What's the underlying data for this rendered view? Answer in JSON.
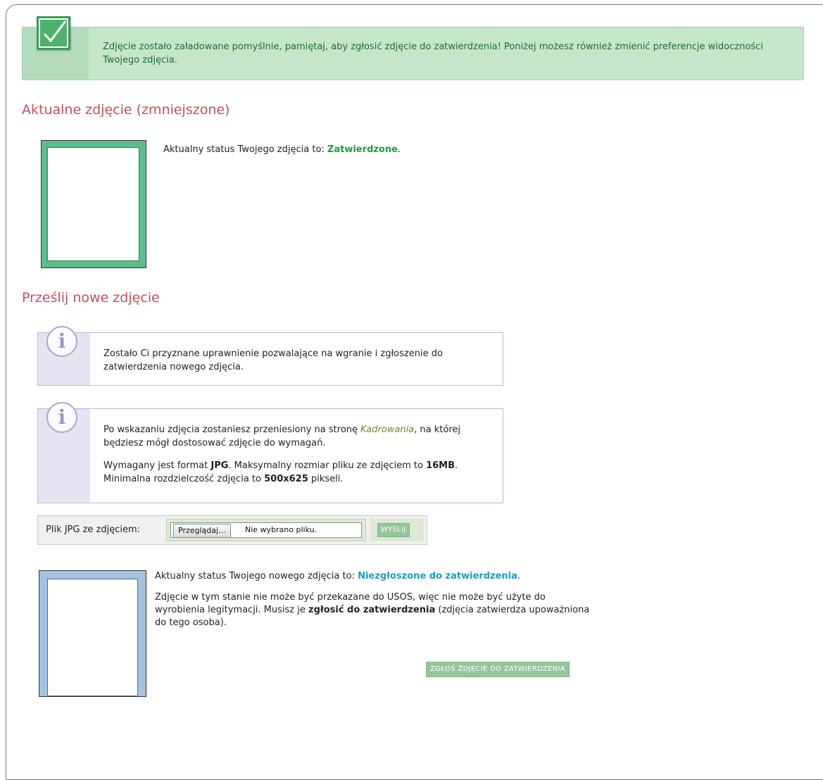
{
  "success_banner": {
    "message": "Zdjęcie zostało załadowane pomyślnie, pamiętaj, aby zgłosić zdjęcie do zatwierdzenia! Poniżej możesz również zmienić preferencje widoczności Twojego zdjęcia.",
    "icon": "checkmark-icon"
  },
  "current_photo": {
    "heading": "Aktualne zdjęcie (zmniejszone)",
    "status_prefix": "Aktualny status Twojego zdjęcia to: ",
    "status_value": "Zatwierdzone",
    "status_suffix": ".",
    "status_color": "#1e9e3c"
  },
  "new_photo": {
    "heading": "Prześlij nowe zdjęcie",
    "info1": {
      "icon": "info-icon",
      "text": "Zostało Ci przyznane uprawnienie pozwalające na wgranie i zgłoszenie do zatwierdzenia nowego zdjęcia."
    },
    "info2": {
      "icon": "info-icon",
      "p1_before": "Po wskazaniu zdjęcia zostaniesz przeniesiony na stronę ",
      "p1_link": "Kadrowania",
      "p1_after": ", na której będziesz mógł dostosować zdjęcie do wymagań.",
      "p2_a": "Wymagany jest format ",
      "p2_format": "JPG",
      "p2_b": ". Maksymalny rozmiar pliku ze zdjęciem to ",
      "p2_size": "16MB",
      "p2_c": ". Minimalna rozdzielczość zdjęcia to ",
      "p2_res": "500x625",
      "p2_d": " pikseli."
    },
    "upload": {
      "label": "Plik JPG ze zdjęciem:",
      "browse_label": "Przeglądaj...",
      "no_file_text": "Nie wybrano pliku.",
      "send_label": "WYŚLIJ"
    },
    "status_prefix": "Aktualny status Twojego nowego zdjęcia to: ",
    "status_value": "Niezgłoszone do zatwierdzenia",
    "status_suffix": ".",
    "status_color": "#1b9cc4",
    "note_a": "Zdjęcie w tym stanie nie może być przekazane do USOS, więc nie może być użyte do wyrobienia legitymacji. Musisz je ",
    "note_bold": "zgłosić do zatwierdzenia",
    "note_b": " (zdjęcia zatwierdza upoważniona do tego osoba).",
    "submit_label": "ZGŁOŚ ZDJĘCIE DO ZATWIERDZENIA"
  },
  "colors": {
    "heading": "#c65058",
    "success_bg": "#c6e6cc",
    "button_green": "#93c69c"
  }
}
